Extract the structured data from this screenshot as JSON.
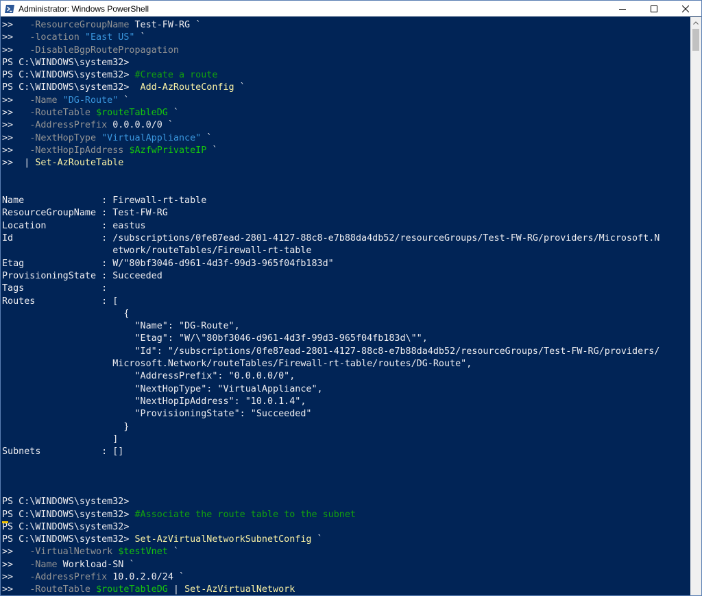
{
  "window": {
    "title": "Administrator: Windows PowerShell",
    "controls": [
      "minimize",
      "maximize",
      "close"
    ]
  },
  "colors": {
    "background": "#012456",
    "text": "#eeedf0",
    "parameter": "#949494",
    "string": "#3a96dd",
    "command": "#f9f1a5",
    "comment": "#13a10e",
    "variable": "#16c60c"
  },
  "console_lines": [
    [
      {
        "t": ">>   ",
        "s": "w"
      },
      {
        "t": "-ResourceGroupName",
        "s": "g"
      },
      {
        "t": " Test-FW-RG `",
        "s": "w"
      }
    ],
    [
      {
        "t": ">>   ",
        "s": "w"
      },
      {
        "t": "-location",
        "s": "g"
      },
      {
        "t": " ",
        "s": "w"
      },
      {
        "t": "\"East US\"",
        "s": "c"
      },
      {
        "t": " `",
        "s": "w"
      }
    ],
    [
      {
        "t": ">>   ",
        "s": "w"
      },
      {
        "t": "-DisableBgpRoutePropagation",
        "s": "g"
      }
    ],
    [
      {
        "t": "PS C:\\WINDOWS\\system32>",
        "s": "w"
      }
    ],
    [
      {
        "t": "PS C:\\WINDOWS\\system32> ",
        "s": "w"
      },
      {
        "t": "#Create a route",
        "s": "gr"
      }
    ],
    [
      {
        "t": "PS C:\\WINDOWS\\system32>  ",
        "s": "w"
      },
      {
        "t": "Add-AzRouteConfig",
        "s": "y"
      },
      {
        "t": " `",
        "s": "w"
      }
    ],
    [
      {
        "t": ">>   ",
        "s": "w"
      },
      {
        "t": "-Name",
        "s": "g"
      },
      {
        "t": " ",
        "s": "w"
      },
      {
        "t": "\"DG-Route\"",
        "s": "c"
      },
      {
        "t": " `",
        "s": "w"
      }
    ],
    [
      {
        "t": ">>   ",
        "s": "w"
      },
      {
        "t": "-RouteTable",
        "s": "g"
      },
      {
        "t": " ",
        "s": "w"
      },
      {
        "t": "$routeTableDG",
        "s": "v"
      },
      {
        "t": " `",
        "s": "w"
      }
    ],
    [
      {
        "t": ">>   ",
        "s": "w"
      },
      {
        "t": "-AddressPrefix",
        "s": "g"
      },
      {
        "t": " 0.0.0.0/0 `",
        "s": "w"
      }
    ],
    [
      {
        "t": ">>   ",
        "s": "w"
      },
      {
        "t": "-NextHopType",
        "s": "g"
      },
      {
        "t": " ",
        "s": "w"
      },
      {
        "t": "\"VirtualAppliance\"",
        "s": "c"
      },
      {
        "t": " `",
        "s": "w"
      }
    ],
    [
      {
        "t": ">>   ",
        "s": "w"
      },
      {
        "t": "-NextHopIpAddress",
        "s": "g"
      },
      {
        "t": " ",
        "s": "w"
      },
      {
        "t": "$AzfwPrivateIP",
        "s": "v"
      },
      {
        "t": " `",
        "s": "w"
      }
    ],
    [
      {
        "t": ">>  | ",
        "s": "w"
      },
      {
        "t": "Set-AzRouteTable",
        "s": "y"
      }
    ],
    [],
    [],
    [
      {
        "t": "Name              : Firewall-rt-table",
        "s": "w"
      }
    ],
    [
      {
        "t": "ResourceGroupName : Test-FW-RG",
        "s": "w"
      }
    ],
    [
      {
        "t": "Location          : eastus",
        "s": "w"
      }
    ],
    [
      {
        "t": "Id                : /subscriptions/0fe87ead-2801-4127-88c8-e7b88da4db52/resourceGroups/Test-FW-RG/providers/Microsoft.N",
        "s": "w"
      }
    ],
    [
      {
        "t": "                    etwork/routeTables/Firewall-rt-table",
        "s": "w"
      }
    ],
    [
      {
        "t": "Etag              : W/\"80bf3046-d961-4d3f-99d3-965f04fb183d\"",
        "s": "w"
      }
    ],
    [
      {
        "t": "ProvisioningState : Succeeded",
        "s": "w"
      }
    ],
    [
      {
        "t": "Tags              :",
        "s": "w"
      }
    ],
    [
      {
        "t": "Routes            : [",
        "s": "w"
      }
    ],
    [
      {
        "t": "                      {",
        "s": "w"
      }
    ],
    [
      {
        "t": "                        \"Name\": \"DG-Route\",",
        "s": "w"
      }
    ],
    [
      {
        "t": "                        \"Etag\": \"W/\\\"80bf3046-d961-4d3f-99d3-965f04fb183d\\\"\",",
        "s": "w"
      }
    ],
    [
      {
        "t": "                        \"Id\": \"/subscriptions/0fe87ead-2801-4127-88c8-e7b88da4db52/resourceGroups/Test-FW-RG/providers/",
        "s": "w"
      }
    ],
    [
      {
        "t": "                    Microsoft.Network/routeTables/Firewall-rt-table/routes/DG-Route\",",
        "s": "w"
      }
    ],
    [
      {
        "t": "                        \"AddressPrefix\": \"0.0.0.0/0\",",
        "s": "w"
      }
    ],
    [
      {
        "t": "                        \"NextHopType\": \"VirtualAppliance\",",
        "s": "w"
      }
    ],
    [
      {
        "t": "                        \"NextHopIpAddress\": \"10.0.1.4\",",
        "s": "w"
      }
    ],
    [
      {
        "t": "                        \"ProvisioningState\": \"Succeeded\"",
        "s": "w"
      }
    ],
    [
      {
        "t": "                      }",
        "s": "w"
      }
    ],
    [
      {
        "t": "                    ]",
        "s": "w"
      }
    ],
    [
      {
        "t": "Subnets           : []",
        "s": "w"
      }
    ],
    [],
    [],
    [],
    [
      {
        "t": "PS C:\\WINDOWS\\system32>",
        "s": "w"
      }
    ],
    [
      {
        "t": "PS C:\\WINDOWS\\system32> ",
        "s": "w"
      },
      {
        "t": "#Associate the route table to the subnet",
        "s": "gr"
      }
    ],
    [
      {
        "t": "PS C:\\WINDOWS\\system32>",
        "s": "w"
      }
    ],
    [
      {
        "t": "PS C:\\WINDOWS\\system32> ",
        "s": "w"
      },
      {
        "t": "Set-AzVirtualNetworkSubnetConfig",
        "s": "y"
      },
      {
        "t": " `",
        "s": "w"
      }
    ],
    [
      {
        "t": ">>   ",
        "s": "w"
      },
      {
        "t": "-VirtualNetwork",
        "s": "g"
      },
      {
        "t": " ",
        "s": "w"
      },
      {
        "t": "$testVnet",
        "s": "v"
      },
      {
        "t": " `",
        "s": "w"
      }
    ],
    [
      {
        "t": ">>   ",
        "s": "w"
      },
      {
        "t": "-Name",
        "s": "g"
      },
      {
        "t": " Workload-SN `",
        "s": "w"
      }
    ],
    [
      {
        "t": ">>   ",
        "s": "w"
      },
      {
        "t": "-AddressPrefix",
        "s": "g"
      },
      {
        "t": " 10.0.2.0/24 `",
        "s": "w"
      }
    ],
    [
      {
        "t": ">>   ",
        "s": "w"
      },
      {
        "t": "-RouteTable",
        "s": "g"
      },
      {
        "t": " ",
        "s": "w"
      },
      {
        "t": "$routeTableDG",
        "s": "v"
      },
      {
        "t": " | ",
        "s": "w"
      },
      {
        "t": "Set-AzVirtualNetwork",
        "s": "y"
      }
    ]
  ]
}
